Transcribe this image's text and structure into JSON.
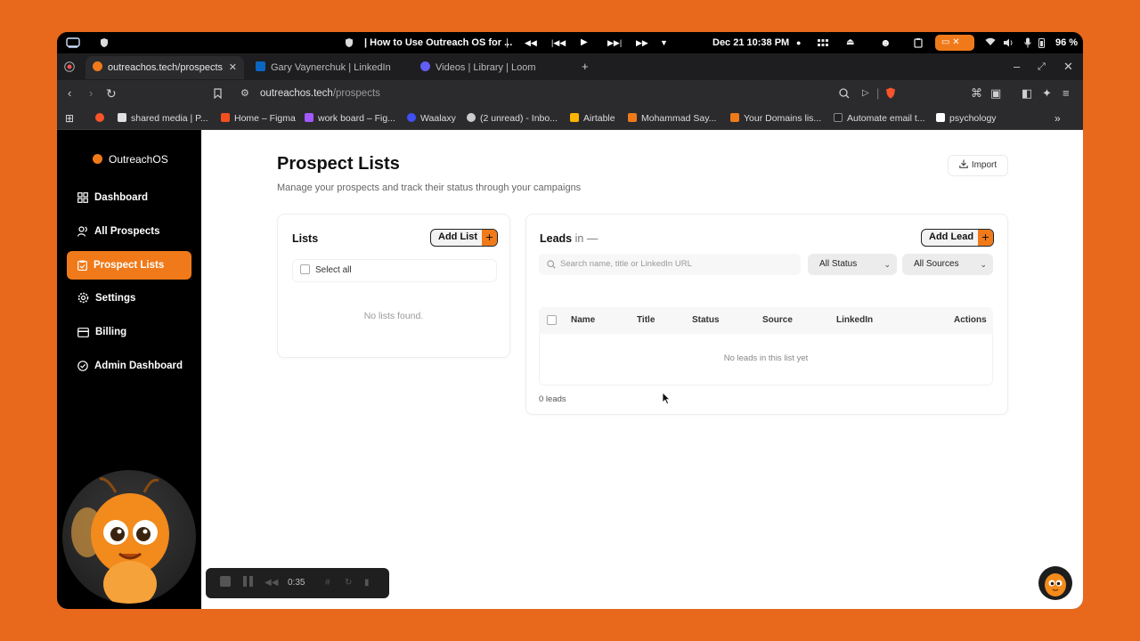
{
  "os": {
    "media_title": "| How to Use Outreach OS for ...",
    "datetime": "Dec 21  10:38 PM",
    "battery": "96 %"
  },
  "tabs": [
    {
      "label": "outreachos.tech/prospects",
      "active": true,
      "favicon_color": "#f07a1a"
    },
    {
      "label": "Gary Vaynerchuk | LinkedIn",
      "active": false,
      "favicon_color": "#0a66c2"
    },
    {
      "label": "Videos | Library | Loom",
      "active": false,
      "favicon_color": "#625df5"
    }
  ],
  "address": {
    "domain": "outreachos.tech",
    "path": "/prospects"
  },
  "bookmarks": [
    {
      "label": "shared media | P...",
      "color": "#e0e0e0"
    },
    {
      "label": "Home – Figma",
      "color": "#f24e1e"
    },
    {
      "label": "work board – Fig...",
      "color": "#a259ff"
    },
    {
      "label": "Waalaxy",
      "color": "#3f51f5"
    },
    {
      "label": "(2 unread) - Inbo...",
      "color": "#cccccc"
    },
    {
      "label": "Airtable",
      "color": "#fcb400"
    },
    {
      "label": "Mohammad Say...",
      "color": "#f07a1a"
    },
    {
      "label": "Your Domains lis...",
      "color": "#f07a1a"
    },
    {
      "label": "Automate email t...",
      "color": "#222222"
    },
    {
      "label": "psychology",
      "color": "#ffffff"
    }
  ],
  "brand": "OutreachOS",
  "nav": [
    {
      "label": "Dashboard",
      "icon": "grid-icon",
      "active": false
    },
    {
      "label": "All Prospects",
      "icon": "users-icon",
      "active": false
    },
    {
      "label": "Prospect Lists",
      "icon": "clipboard-icon",
      "active": true
    },
    {
      "label": "Settings",
      "icon": "gear-icon",
      "active": false
    },
    {
      "label": "Billing",
      "icon": "card-icon",
      "active": false
    },
    {
      "label": "Admin Dashboard",
      "icon": "check-circle-icon",
      "active": false
    }
  ],
  "recorder": {
    "time": "0:35"
  },
  "page": {
    "title": "Prospect Lists",
    "subtitle": "Manage your prospects and track their status through your campaigns",
    "import_label": "Import"
  },
  "lists": {
    "heading": "Lists",
    "add_label": "Add List",
    "select_all": "Select all",
    "empty": "No lists found."
  },
  "leads": {
    "heading": "Leads",
    "heading_suffix": "in —",
    "add_label": "Add Lead",
    "search_placeholder": "Search name, title or LinkedIn URL",
    "status_filter": "All Status",
    "source_filter": "All Sources",
    "columns": [
      "Name",
      "Title",
      "Status",
      "Source",
      "LinkedIn",
      "Actions"
    ],
    "empty": "No leads in this list yet",
    "count": "0 leads"
  },
  "colors": {
    "accent": "#f07a1a",
    "background": "#e8681c",
    "sidebar": "#000000"
  }
}
